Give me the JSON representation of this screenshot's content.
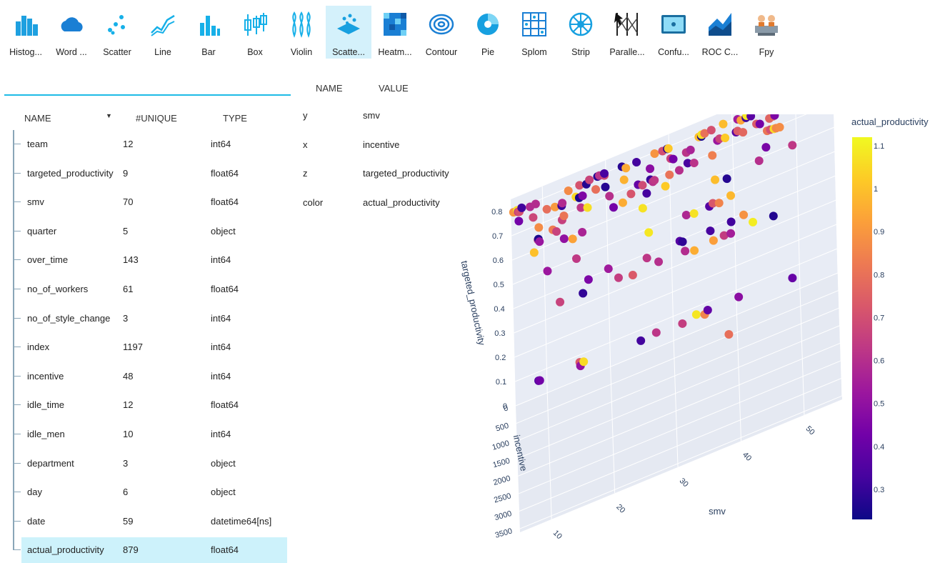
{
  "toolbar": {
    "items": [
      {
        "label": "Histog...",
        "icon": "histogram-icon"
      },
      {
        "label": "Word ...",
        "icon": "word-cloud-icon"
      },
      {
        "label": "Scatter",
        "icon": "scatter-icon"
      },
      {
        "label": "Line",
        "icon": "line-icon"
      },
      {
        "label": "Bar",
        "icon": "bar-icon"
      },
      {
        "label": "Box",
        "icon": "box-icon"
      },
      {
        "label": "Violin",
        "icon": "violin-icon"
      },
      {
        "label": "Scatte...",
        "icon": "scatter-3d-icon",
        "active": true
      },
      {
        "label": "Heatm...",
        "icon": "heatmap-icon"
      },
      {
        "label": "Contour",
        "icon": "contour-icon"
      },
      {
        "label": "Pie",
        "icon": "pie-icon"
      },
      {
        "label": "Splom",
        "icon": "splom-icon"
      },
      {
        "label": "Strip",
        "icon": "strip-icon"
      },
      {
        "label": "Paralle...",
        "icon": "parallel-icon"
      },
      {
        "label": "Confu...",
        "icon": "confusion-icon"
      },
      {
        "label": "ROC C...",
        "icon": "roc-icon"
      },
      {
        "label": "Fpy",
        "icon": "fpy-icon"
      }
    ]
  },
  "columns": {
    "headers": {
      "name": "NAME",
      "unique": "#UNIQUE",
      "type": "TYPE"
    },
    "selected_index": 14,
    "rows": [
      {
        "name": "team",
        "unique": "12",
        "type": "int64"
      },
      {
        "name": "targeted_productivity",
        "unique": "9",
        "type": "float64"
      },
      {
        "name": "smv",
        "unique": "70",
        "type": "float64"
      },
      {
        "name": "quarter",
        "unique": "5",
        "type": "object"
      },
      {
        "name": "over_time",
        "unique": "143",
        "type": "int64"
      },
      {
        "name": "no_of_workers",
        "unique": "61",
        "type": "float64"
      },
      {
        "name": "no_of_style_change",
        "unique": "3",
        "type": "int64"
      },
      {
        "name": "index",
        "unique": "1197",
        "type": "int64"
      },
      {
        "name": "incentive",
        "unique": "48",
        "type": "int64"
      },
      {
        "name": "idle_time",
        "unique": "12",
        "type": "float64"
      },
      {
        "name": "idle_men",
        "unique": "10",
        "type": "int64"
      },
      {
        "name": "department",
        "unique": "3",
        "type": "object"
      },
      {
        "name": "day",
        "unique": "6",
        "type": "object"
      },
      {
        "name": "date",
        "unique": "59",
        "type": "datetime64[ns]"
      },
      {
        "name": "actual_productivity",
        "unique": "879",
        "type": "float64"
      }
    ]
  },
  "params": {
    "headers": {
      "name": "NAME",
      "value": "VALUE"
    },
    "rows": [
      {
        "name": "y",
        "value": "smv"
      },
      {
        "name": "x",
        "value": "incentive"
      },
      {
        "name": "z",
        "value": "targeted_productivity"
      },
      {
        "name": "color",
        "value": "actual_productivity"
      }
    ]
  },
  "chart_data": {
    "type": "scatter",
    "projection": "3d",
    "x_axis": {
      "label": "incentive",
      "ticks": [
        "0",
        "500",
        "1000",
        "1500",
        "2000",
        "2500",
        "3000",
        "3500"
      ]
    },
    "y_axis": {
      "label": "smv",
      "ticks": [
        "10",
        "20",
        "30",
        "40",
        "50"
      ]
    },
    "z_axis": {
      "label": "targeted_productivity",
      "ticks": [
        "0",
        "0.1",
        "0.2",
        "0.3",
        "0.4",
        "0.5",
        "0.6",
        "0.7",
        "0.8"
      ]
    },
    "colorbar": {
      "title": "actual_productivity",
      "ticks": [
        "1.1",
        "1",
        "0.9",
        "0.8",
        "0.7",
        "0.6",
        "0.5",
        "0.4",
        "0.3"
      ],
      "range": [
        0.23,
        1.12
      ],
      "colorscale": [
        "#0d0887",
        "#46039f",
        "#7201a8",
        "#9c179e",
        "#bd3786",
        "#d8576b",
        "#ed7953",
        "#fb9f3a",
        "#fdca26",
        "#f0f921"
      ]
    },
    "grid": true
  }
}
